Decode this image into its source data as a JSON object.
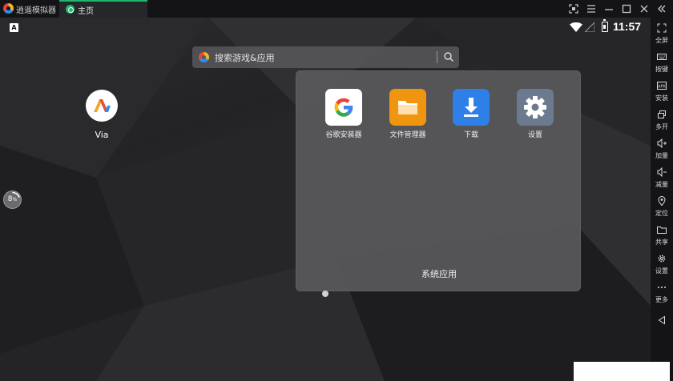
{
  "titlebar": {
    "app_title": "逍遥模拟器",
    "tab_home_label": "主页",
    "controls": [
      "screenshot-icon",
      "menu-icon",
      "minimize-icon",
      "maximize-icon",
      "close-icon",
      "collapse-icon"
    ]
  },
  "statusbar": {
    "notification_letter": "A",
    "time": "11:57"
  },
  "search": {
    "placeholder": "搜索游戏&应用"
  },
  "desktop": {
    "apps": [
      {
        "label": "Via"
      }
    ],
    "progress": {
      "value": "8",
      "unit": "%",
      "fraction": 0.08
    }
  },
  "folder": {
    "name": "系统应用",
    "apps": [
      {
        "label": "谷歌安装器",
        "icon": "google-icon",
        "bg": "#ffffff"
      },
      {
        "label": "文件管理器",
        "icon": "folder-icon",
        "bg": "#f0950f"
      },
      {
        "label": "下载",
        "icon": "download-icon",
        "bg": "#2e7fe8"
      },
      {
        "label": "设置",
        "icon": "gear-icon",
        "bg": "#6c7a8f"
      }
    ]
  },
  "toolbar": {
    "items": [
      {
        "label": "全屏",
        "icon": "fullscreen-icon"
      },
      {
        "label": "按键",
        "icon": "keyboard-icon"
      },
      {
        "label": "安装",
        "icon": "apk-icon"
      },
      {
        "label": "多开",
        "icon": "multi-window-icon"
      },
      {
        "label": "加量",
        "icon": "volume-up-icon"
      },
      {
        "label": "减量",
        "icon": "volume-down-icon"
      },
      {
        "label": "定位",
        "icon": "location-icon"
      },
      {
        "label": "共享",
        "icon": "share-folder-icon"
      },
      {
        "label": "设置",
        "icon": "settings-icon"
      },
      {
        "label": "更多",
        "icon": "more-icon"
      }
    ],
    "nav": [
      "back-icon"
    ]
  },
  "colors": {
    "accent": "#1fb86a",
    "titlebar_bg": "#141416",
    "folder_bg": "#58585a"
  }
}
